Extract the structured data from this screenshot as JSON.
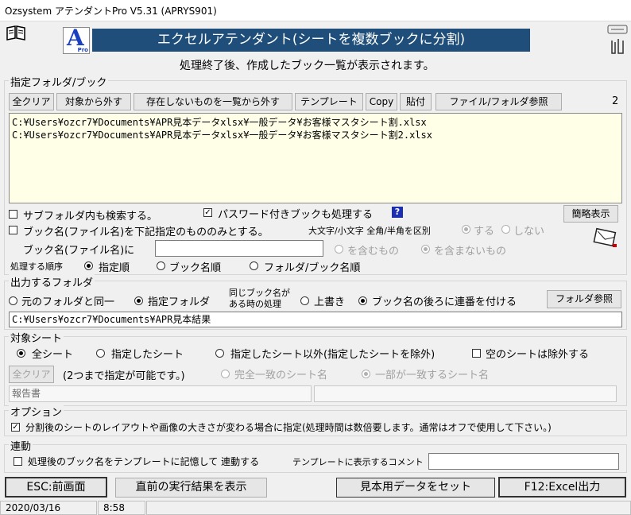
{
  "window": {
    "title": "Ozsystem アテンダントPro V5.31 (APRYS901)"
  },
  "header": {
    "banner": "エクセルアテンダント(シートを複数ブックに分割)",
    "subtitle": "処理終了後、作成したブック一覧が表示されます。",
    "logo_letter": "A",
    "logo_sub": "Pro"
  },
  "folder_book": {
    "label": "指定フォルダ/ブック",
    "buttons": {
      "clear_all": "全クリア",
      "remove": "対象から外す",
      "remove_missing": "存在しないものを一覧から外す",
      "template": "テンプレート",
      "copy": "Copy",
      "paste": "貼付",
      "browse": "ファイル/フォルダ参照"
    },
    "count": "2",
    "files": [
      "C:¥Users¥ozcr7¥Documents¥APR見本データxlsx¥一般データ¥お客様マスタシート割.xlsx",
      "C:¥Users¥ozcr7¥Documents¥APR見本データxlsx¥一般データ¥お客様マスタシート割2.xlsx"
    ],
    "search_subfolders": "サブフォルダ内も検索する。",
    "password_books": "パスワード付きブックも処理する",
    "help_mark": "?",
    "simple_view": "簡略表示",
    "book_name_filter": "ブック名(ファイル名)を下記指定のもののみとする。",
    "case_label": "大文字/小文字 全角/半角を区別",
    "case_yes": "する",
    "case_no": "しない",
    "book_name_prefix": "ブック名(ファイル名)に",
    "book_name_value": "",
    "contains": "を含むもの",
    "not_contains": "を含まないもの",
    "order_label": "処理する順序",
    "order_specified": "指定順",
    "order_book": "ブック名順",
    "order_folder_book": "フォルダ/ブック名順"
  },
  "output": {
    "label": "出力するフォルダ",
    "same_as_source": "元のフォルダと同一",
    "specified": "指定フォルダ",
    "same_name_line1": "同じブック名が",
    "same_name_line2": "ある時の処理",
    "overwrite": "上書き",
    "sequence": "ブック名の後ろに連番を付ける",
    "browse": "フォルダ参照",
    "path": "C:¥Users¥ozcr7¥Documents¥APR見本結果"
  },
  "sheets": {
    "label": "対象シート",
    "all": "全シート",
    "specified": "指定したシート",
    "except": "指定したシート以外(指定したシートを除外)",
    "exclude_empty": "空のシートは除外する",
    "clear_all": "全クリア",
    "note": "(2つまで指定が可能です。)",
    "exact_match": "完全一致のシート名",
    "partial_match": "一部が一致するシート名",
    "name1": "報告書",
    "name2": ""
  },
  "options": {
    "label": "オプション",
    "layout_change": "分割後のシートのレイアウトや画像の大きさが変わる場合に指定(処理時間は数倍要します。通常はオフで使用して下さい。)"
  },
  "link": {
    "label": "連動",
    "remember": "処理後のブック名をテンプレートに記憶して 連動する",
    "comment_label": "テンプレートに表示するコメント",
    "comment_value": ""
  },
  "footer": {
    "esc": "ESC:前画面",
    "show_last": "直前の実行結果を表示",
    "sample": "見本用データをセット",
    "f12": "F12:Excel出力"
  },
  "status": {
    "date": "2020/03/16",
    "time": "8:58"
  },
  "colors": {
    "banner_bg": "#1e4e79",
    "list_bg": "#ffffe8",
    "logo_blue": "#1a3fbf"
  }
}
